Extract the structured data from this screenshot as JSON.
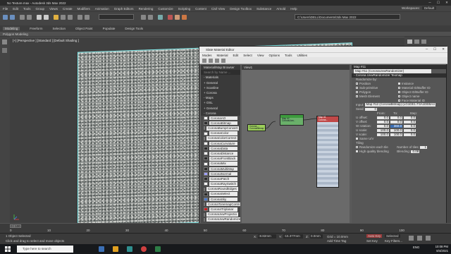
{
  "app": {
    "title": "No Texture.max - Autodesk 3ds Max 2022",
    "menu": [
      "File",
      "Edit",
      "Tools",
      "Group",
      "Views",
      "Create",
      "Modifiers",
      "Animation",
      "Graph Editors",
      "Rendering",
      "Customize",
      "Scripting",
      "Content",
      "Civil View",
      "Design Toolbox",
      "Substance",
      "Arnold",
      "Help"
    ],
    "workspaces_label": "Workspaces:",
    "workspaces_value": "Default",
    "path": "C:\\Users\\DELL\\Documents\\3ds Max 2022"
  },
  "ribbon": {
    "tabs": [
      "Modeling",
      "Freeform",
      "Selection",
      "Object Paint",
      "Populate",
      "Design Tools"
    ],
    "sub": "Polygon Modeling"
  },
  "viewport": {
    "label": "[+] [Perspective ] [Standard ] [Default Shading ]"
  },
  "sme": {
    "title": "Slate Material Editor",
    "menu": [
      "Modes",
      "Material",
      "Edit",
      "Select",
      "View",
      "Options",
      "Tools",
      "Utilities"
    ],
    "browser_title": "Material/Map Browser",
    "search_placeholder": "Search by Name ...",
    "browser_rows": [
      {
        "kind": "hdr",
        "text": "- Materials"
      },
      {
        "kind": "hdr",
        "text": "+ General"
      },
      {
        "kind": "hdr",
        "text": "+ Scanline"
      },
      {
        "kind": "hdr",
        "text": "+ Corona"
      },
      {
        "kind": "hdr",
        "text": "- Maps"
      },
      {
        "kind": "hdr",
        "text": "+ OSL"
      },
      {
        "kind": "hdr",
        "text": "+ General"
      },
      {
        "kind": "hdr",
        "text": "- Corona"
      }
    ],
    "maps": [
      {
        "name": "CoronaAO",
        "sw": "#ffffff"
      },
      {
        "name": "CoronaBitmap",
        "sw": "#2a2a2a"
      },
      {
        "name": "CoronaBumpConvert",
        "sw": "#2a2a2a"
      },
      {
        "name": "CoronaColor",
        "sw": "#ffffff"
      },
      {
        "name": "CoronaColorCorrect",
        "sw": "#2a2a2a"
      },
      {
        "name": "CoronaCurvature",
        "sw": "#ffffff"
      },
      {
        "name": "CoronaData",
        "sw": "#2a2a2a"
      },
      {
        "name": "CoronaDistance",
        "sw": "#ffffff"
      },
      {
        "name": "CoronaFrontBack",
        "sw": "#2a2a2a"
      },
      {
        "name": "CoronaMix",
        "sw": "#ffffff"
      },
      {
        "name": "CoronaMultiMap",
        "sw": "#2a2a2a"
      },
      {
        "name": "CoronaNormal",
        "sw": "#a0a0ff"
      },
      {
        "name": "CoronaPatch",
        "sw": "#2a2a2a"
      },
      {
        "name": "CoronaRaySwitch",
        "sw": "#ffffff"
      },
      {
        "name": "CoronaRoundEdges",
        "sw": "#2a2a2a"
      },
      {
        "name": "CoronaSelect",
        "sw": "#2a2a2a"
      },
      {
        "name": "CoronaSky",
        "sw": "#4a78c8"
      },
      {
        "name": "CoronaTonemapControl",
        "sw": "#2a2a2a"
      },
      {
        "name": "CoronaTriplanar",
        "sw": "#c82020"
      },
      {
        "name": "CoronaUvwProjectio",
        "sw": "#c82020"
      },
      {
        "name": "CoronaUvwRandomizer",
        "sw": "#2a2a2a"
      },
      {
        "name": "CoronaWire",
        "sw": "#ffffff"
      }
    ],
    "view_tab": "View1",
    "node1": "Corona ...\nCoronaBitmap",
    "node2": "Map #2\nCoronaUvw...",
    "node3": "Map #1\nCorona...",
    "props_header": "Map #11",
    "props_name": "Map #11 (CoronaUvwRandomizer)",
    "rollout": "- Corona UvwRandomizer Texmap",
    "randomize_by": "Randomize by:",
    "rand_left": [
      "Position",
      "Sub-primitive",
      "Polygon",
      "Mesh Element"
    ],
    "rand_right": [
      "Instance",
      "Material ID/Buffer ID",
      "Object ID/Buffer ID",
      "Object name",
      "Face Material ID"
    ],
    "input_label": "Input:",
    "input_value": "Map #12 (CoronaBitmap) (LG1DE1 F3A1DEBA4 seed)",
    "seed_label": "Seed:",
    "seed_value": "0",
    "cols": [
      "From:",
      "To:",
      "Step:"
    ],
    "rows": [
      {
        "label": "U offset:",
        "from": "0.0",
        "to": "0.0",
        "step": "0.0"
      },
      {
        "label": "V offset:",
        "from": "0.0",
        "to": "0.0",
        "step": "0.0"
      },
      {
        "label": "W rotation:",
        "from": "0.0",
        "to": "360.0",
        "step": "0.0"
      },
      {
        "label": "U scale:",
        "from": "100.0",
        "to": "100.0",
        "step": "0.0"
      },
      {
        "label": "V scale:",
        "from": "100.0",
        "to": "100.0",
        "step": "0.0"
      }
    ],
    "same_uv": "Same U/V",
    "tiling": "Tiling",
    "randomize_each": "Randomize each tile",
    "number_tiles_label": "Number of tiles:",
    "number_tiles_value": "1",
    "high_quality": "High quality blending",
    "blending_label": "Blending:",
    "blending_value": "0.08",
    "status": "Rendering finished"
  },
  "timeline": {
    "frame": "0 / 100",
    "ticks": [
      "0",
      "10",
      "20",
      "30",
      "40",
      "50",
      "60",
      "70",
      "80",
      "90",
      "100"
    ]
  },
  "status": {
    "selected": "1 Object Selected",
    "hint": "Click and drag to select and move objects",
    "x_label": "X:",
    "x_value": "-8.82mm",
    "y_label": "Y:",
    "y_value": "-15.377mm",
    "z_label": "Z:",
    "z_value": "0.0mm",
    "grid": "Grid = 10.0mm",
    "add_time_tag": "Add Time Tag",
    "autokey": "Auto Key",
    "selected_label": "Selected",
    "setkey": "Set Key",
    "keyfilters": "Key Filters..."
  },
  "taskbar": {
    "search_placeholder": "Type here to search",
    "lang": "ENG",
    "time": "10:08 PM",
    "date": "8/4/2021"
  }
}
